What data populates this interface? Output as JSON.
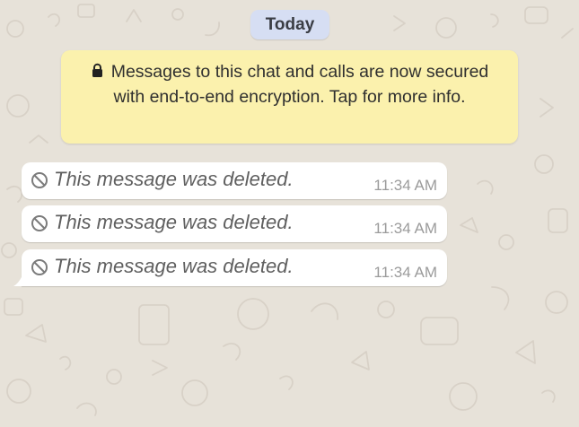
{
  "chat": {
    "date_label": "Today",
    "encryption_notice": {
      "icon": "lock-icon",
      "text": "Messages to this chat and calls are now secured with end-to-end encryption. Tap for more info."
    },
    "messages": [
      {
        "icon": "blocked-icon",
        "text": "This message was deleted.",
        "time": "11:34 AM"
      },
      {
        "icon": "blocked-icon",
        "text": "This message was deleted.",
        "time": "11:34 AM"
      },
      {
        "icon": "blocked-icon",
        "text": "This message was deleted.",
        "time": "11:34 AM"
      }
    ]
  },
  "colors": {
    "wallpaper": "#e7e2d9",
    "date_pill": "#d6def3",
    "system_notice": "#fbf1ad",
    "incoming_bubble": "#ffffff",
    "timestamp": "#9b9b9b",
    "deleted_text": "#5f5f5f"
  }
}
